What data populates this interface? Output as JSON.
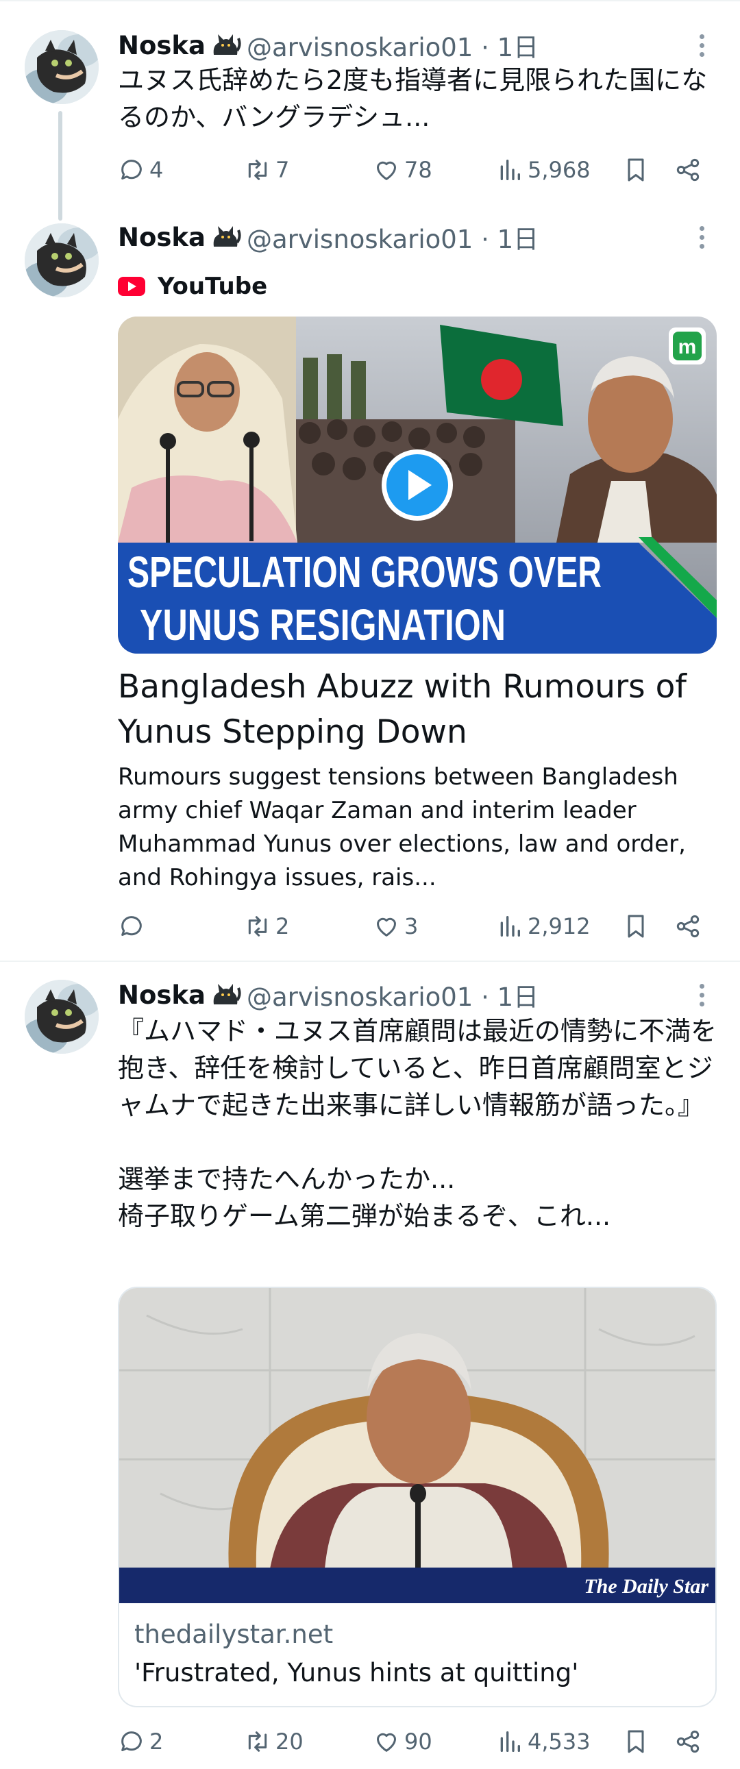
{
  "tweets": [
    {
      "name": "Noska",
      "handle": "@arvisnoskario01 · 1日",
      "text": "ユヌス氏辞めたら2度も指導者に見限られた国になるのか、バングラデシュ...",
      "actions": {
        "replies": "4",
        "retweets": "7",
        "likes": "78",
        "views": "5,968"
      }
    },
    {
      "name": "Noska",
      "handle": "@arvisnoskario01 · 1日",
      "source": "YouTube",
      "media": {
        "banner_line1": "SPECULATION GROWS OVER",
        "banner_line2": "YUNUS RESIGNATION",
        "badge": "m"
      },
      "card_title": "Bangladesh Abuzz with Rumours of Yunus Stepping Down",
      "card_desc": "Rumours suggest tensions between Bangladesh army chief Waqar Zaman and interim leader Muhammad Yunus over elections, law and order, and Rohingya issues, rais...",
      "actions": {
        "replies": "",
        "retweets": "2",
        "likes": "3",
        "views": "2,912"
      }
    },
    {
      "name": "Noska",
      "handle": "@arvisnoskario01 · 1日",
      "text": "『ムハマド・ユヌス首席顧問は最近の情勢に不満を抱き、辞任を検討していると、昨日首席顧問室とジャムナで起きた出来事に詳しい情報筋が語った。』\n\n選挙まで持たへんかったか...\n椅子取りゲーム第二弾が始まるぞ、これ...",
      "link": {
        "watermark": "The Daily Star",
        "domain": "thedailystar.net",
        "title": "'Frustrated, Yunus hints at quitting'"
      },
      "actions": {
        "replies": "2",
        "retweets": "20",
        "likes": "90",
        "views": "4,533"
      }
    }
  ],
  "colors": {
    "text": "#0f1419",
    "secondary": "#536471",
    "youtube_red": "#ff0033",
    "banner_blue": "#1a4fb4",
    "play_blue": "#1d9bf0",
    "daily_star_bar": "#16296b"
  }
}
